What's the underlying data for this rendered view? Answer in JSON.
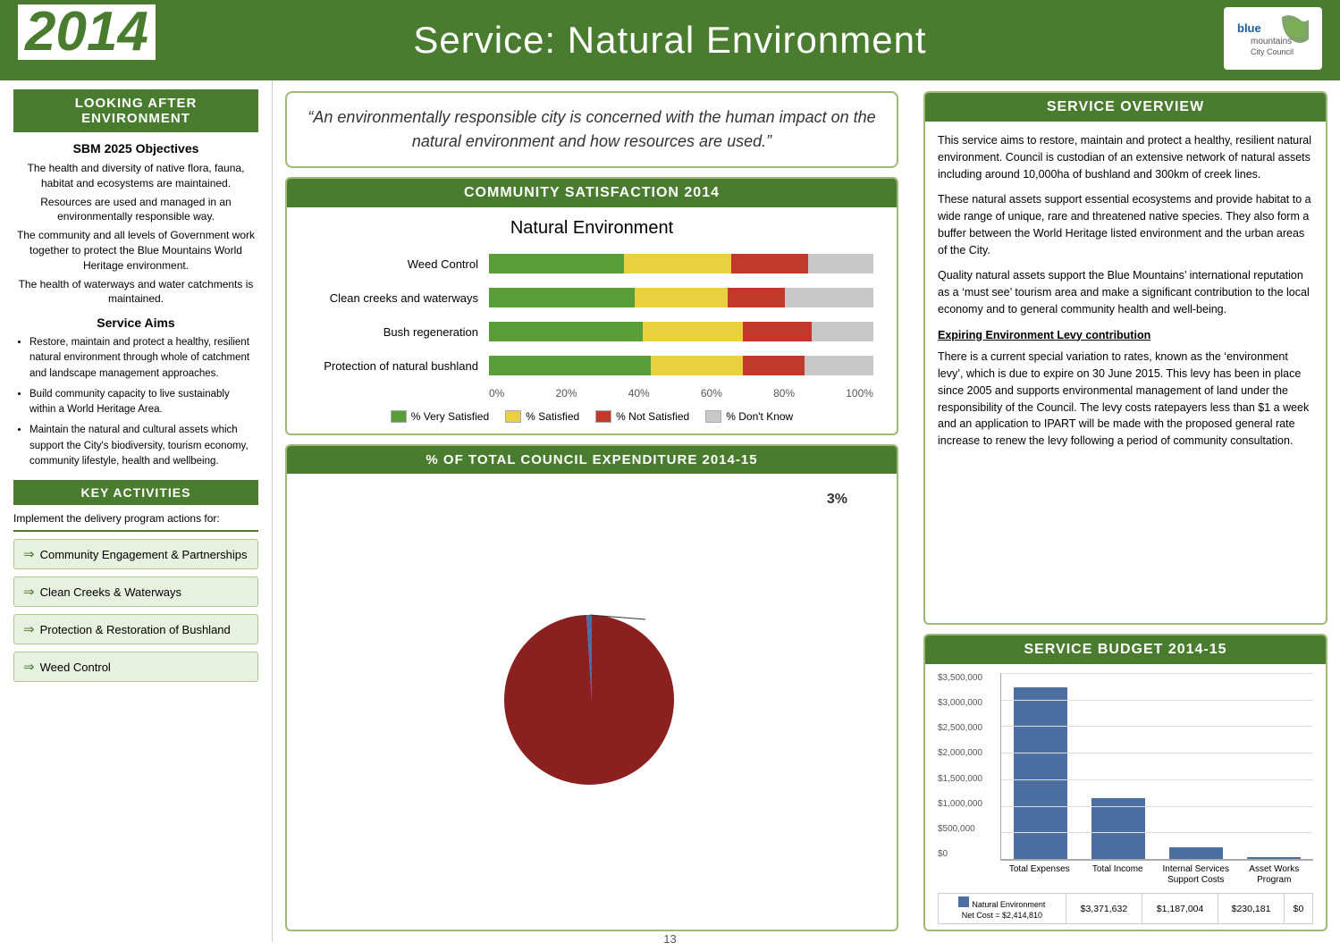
{
  "header": {
    "year": "2014",
    "title": "Service: Natural Environment",
    "logo_line1": "blue",
    "logo_line2": "mountains",
    "logo_line3": "City Council"
  },
  "sidebar": {
    "section_title": "Looking After Environment",
    "objectives_title": "SBM  2025 Objectives",
    "objectives": [
      "The health and diversity of native flora, fauna, habitat and ecosystems are maintained.",
      "Resources are used and managed in an environmentally responsible way.",
      "The community and all levels of Government work together to protect the Blue Mountains World Heritage environment.",
      "The health of waterways and water catchments is maintained."
    ],
    "service_aims_title": "Service Aims",
    "service_aims": [
      "Restore, maintain and protect a healthy, resilient natural environment through whole of catchment and landscape management approaches.",
      "Build community capacity to live sustainably within a World Heritage Area.",
      "Maintain the natural and cultural assets which support the City's biodiversity, tourism economy, community lifestyle, health and wellbeing."
    ],
    "key_activities_title": "Key Activities",
    "delivery_text": "Implement the delivery program actions for:",
    "activities": [
      "Community Engagement & Partnerships",
      "Clean Creeks & Waterways",
      "Protection & Restoration of Bushland",
      "Weed Control"
    ]
  },
  "quote": "“An environmentally responsible city is concerned with the human impact on the natural environment and how resources are used.”",
  "community_satisfaction": {
    "header": "Community Satisfaction 2014",
    "chart_title": "Natural Environment",
    "bars": [
      {
        "label": "Weed Control",
        "very_satisfied": 35,
        "satisfied": 28,
        "not_satisfied": 20,
        "dont_know": 17
      },
      {
        "label": "Clean creeks and waterways",
        "very_satisfied": 38,
        "satisfied": 24,
        "not_satisfied": 15,
        "dont_know": 23
      },
      {
        "label": "Bush regeneration",
        "very_satisfied": 40,
        "satisfied": 26,
        "not_satisfied": 18,
        "dont_know": 16
      },
      {
        "label": "Protection of natural bushland",
        "very_satisfied": 42,
        "satisfied": 24,
        "not_satisfied": 16,
        "dont_know": 18
      }
    ],
    "axis_labels": [
      "0%",
      "20%",
      "40%",
      "60%",
      "80%",
      "100%"
    ],
    "legend": [
      {
        "label": "% Very Satisfied",
        "color": "#5a9e3a"
      },
      {
        "label": "% Satisfied",
        "color": "#e8d040"
      },
      {
        "label": "% Not Satisfied",
        "color": "#c0392b"
      },
      {
        "label": "% Don’t Know",
        "color": "#c8c8c8"
      }
    ]
  },
  "expenditure": {
    "header": "% of Total Council Expenditure 2014-15",
    "percent_label": "3%",
    "pie": {
      "main_color": "#8b2020",
      "slice_color": "#4a6fa0",
      "remainder_color": "#8b2020"
    }
  },
  "service_overview": {
    "header": "Service Overview",
    "paragraphs": [
      "This service aims to restore, maintain and protect a healthy, resilient natural environment. Council is custodian of an extensive network of natural assets including around 10,000ha of bushland and 300km of creek lines.",
      "These natural assets support essential ecosystems and provide habitat to a wide range of unique, rare and threatened native species. They also form a buffer between the World Heritage listed environment and the urban areas of the City.",
      "Quality natural assets support the Blue Mountains’ international reputation as a ‘must see’ tourism area and make a significant contribution to the local economy and to general community health and well-being.",
      "Expiring Environment Levy contribution",
      "There is a current special variation to rates, known as the ‘environment levy’, which is due to expire on 30 June 2015.  This levy has been in place since 2005 and supports environmental management of land under the responsibility of the Council. The levy costs ratepayers less than $1 a week and an application to IPART will be made with the proposed general rate increase to renew the levy following a period of community consultation."
    ],
    "levy_underline": "Expiring Environment Levy contribution"
  },
  "budget": {
    "header": "Service Budget 2014-15",
    "y_axis_labels": [
      "$3,500,000",
      "$3,000,000",
      "$2,500,000",
      "$2,000,000",
      "$1,500,000",
      "$1,000,000",
      "$500,000",
      "$0"
    ],
    "bars": [
      {
        "label": "Total Expenses",
        "height_pct": 96,
        "value": "$3,371,632"
      },
      {
        "label": "Total Income",
        "height_pct": 34,
        "value": "$1,187,004"
      },
      {
        "label": "Internal Services Support Costs",
        "height_pct": 7,
        "value": "$230,181"
      },
      {
        "label": "Asset Works Program",
        "height_pct": 0.5,
        "value": "$0"
      }
    ],
    "table": {
      "legend_label": "Natural Environment",
      "net_cost": "Net Cost = $2,414,810",
      "columns": [
        "Total Expenses",
        "Total Income",
        "Internal Services Support Costs",
        "Asset Works Program"
      ],
      "values": [
        "$3,371,632",
        "$1,187,004",
        "$230,181",
        "$0"
      ]
    }
  },
  "page_number": "13"
}
